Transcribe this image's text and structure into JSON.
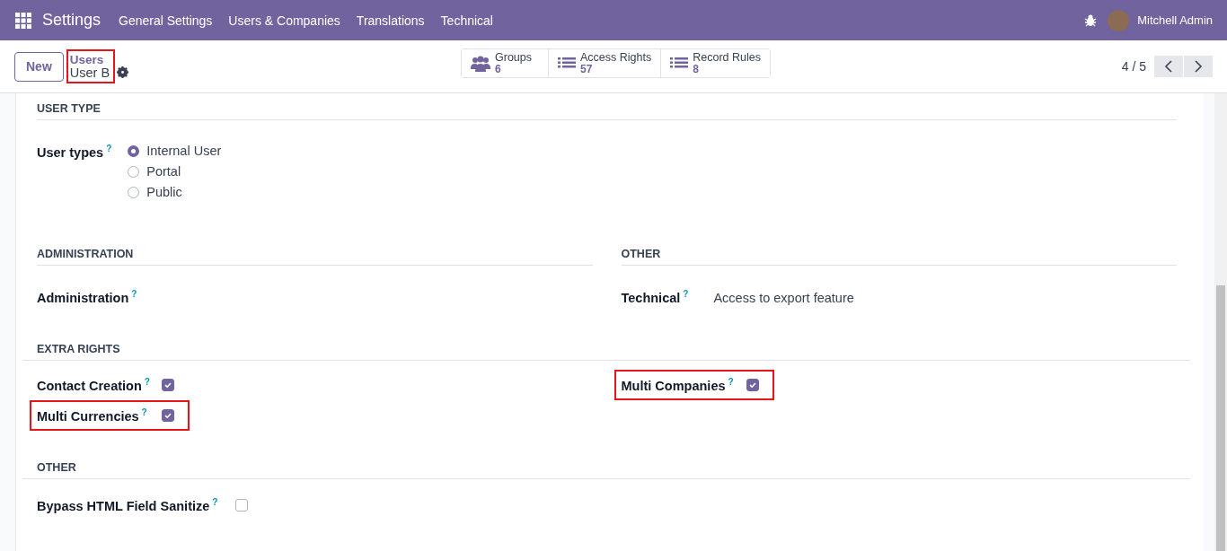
{
  "topbar": {
    "app": "Settings",
    "menu": [
      "General Settings",
      "Users & Companies",
      "Translations",
      "Technical"
    ],
    "user": "Mitchell Admin"
  },
  "control_panel": {
    "new_button": "New",
    "breadcrumb": {
      "parent": "Users",
      "current": "User B",
      "highlighted": true
    },
    "smart_buttons": [
      {
        "kind": "groups",
        "label": "Groups",
        "count": "6"
      },
      {
        "kind": "list",
        "label": "Access Rights",
        "count": "57"
      },
      {
        "kind": "list",
        "label": "Record Rules",
        "count": "8"
      }
    ],
    "pager": "4 / 5"
  },
  "user_type": {
    "title": "USER TYPE",
    "label": "User types",
    "help": "?",
    "options": [
      {
        "label": "Internal User",
        "selected": true
      },
      {
        "label": "Portal",
        "selected": false
      },
      {
        "label": "Public",
        "selected": false
      }
    ]
  },
  "groups": [
    {
      "title": "ADMINISTRATION",
      "label": "Administration",
      "help": "?"
    },
    {
      "title": "OTHER",
      "label": "Technical",
      "help": "?",
      "value": "Access to export feature"
    }
  ],
  "extra_rights": {
    "title": "EXTRA RIGHTS",
    "columns": [
      [
        {
          "label": "Contact Creation",
          "help": "?",
          "checked": true,
          "highlighted": false
        },
        {
          "label": "Multi Currencies",
          "help": "?",
          "checked": true,
          "highlighted": true
        }
      ],
      [
        {
          "label": "Multi Companies",
          "help": "?",
          "checked": true,
          "highlighted": true
        }
      ]
    ]
  },
  "other": {
    "title": "OTHER",
    "fields": [
      {
        "label": "Bypass HTML Field Sanitize",
        "help": "?",
        "checked": false,
        "highlighted": false
      }
    ]
  }
}
